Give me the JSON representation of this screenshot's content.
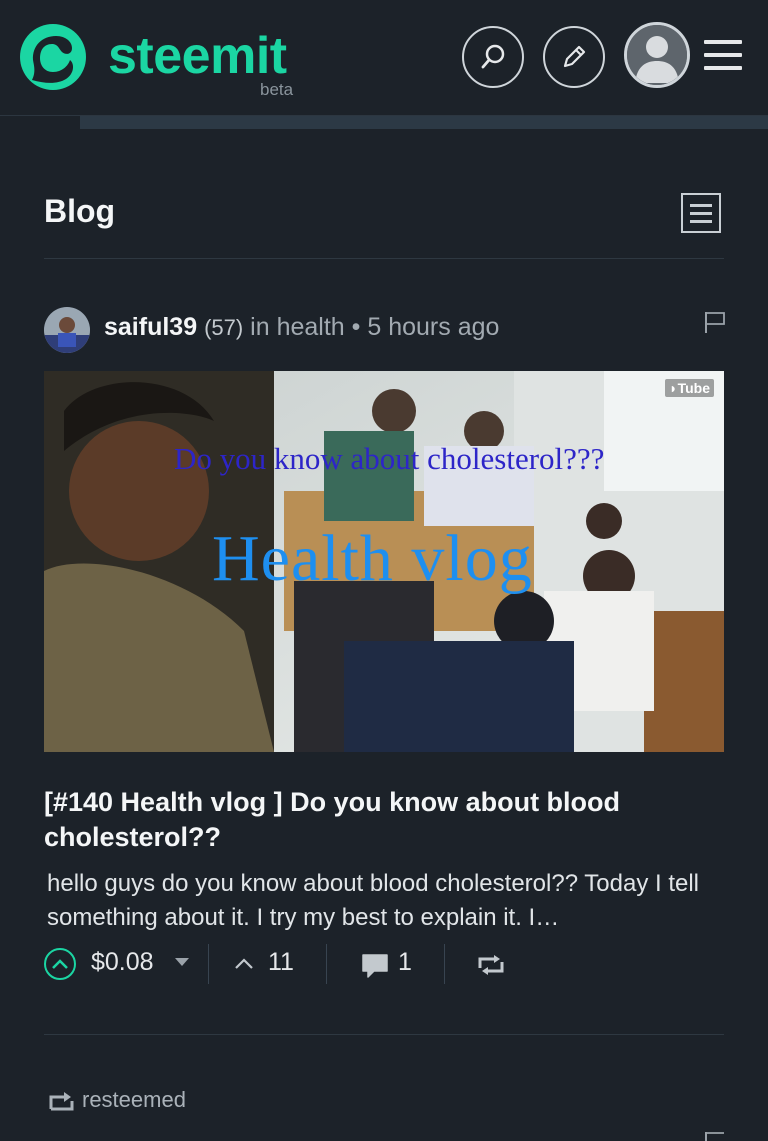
{
  "header": {
    "brand": "steemit",
    "beta": "beta",
    "brand_color": "#1bd6a3"
  },
  "blog": {
    "title": "Blog"
  },
  "post": {
    "author": "saiful39",
    "reputation": "(57)",
    "category_prefix": "in",
    "category": "health",
    "separator": "•",
    "time": "5 hours ago",
    "thumbnail": {
      "badge": "Tube",
      "overlay_question": "Do  you know about cholesterol???",
      "overlay_title": "Health vlog"
    },
    "title": "[#140 Health vlog ] Do you know about blood cholesterol??",
    "excerpt": "hello guys do you know about blood cholesterol?? Today I tell something about it. I try my best to explain it. I…",
    "payout": "$0.08",
    "votes": "11",
    "comments": "1"
  },
  "next_post": {
    "resteemed_label": "resteemed"
  },
  "icons": {
    "search": "search-icon",
    "edit": "pencil-icon",
    "avatar": "user-avatar",
    "menu": "hamburger-menu-icon",
    "layout": "layout-toggle-icon",
    "flag": "flag-icon",
    "upvote": "upvote-chevron-icon",
    "comment": "comment-bubble-icon",
    "resteem": "resteem-icon"
  }
}
